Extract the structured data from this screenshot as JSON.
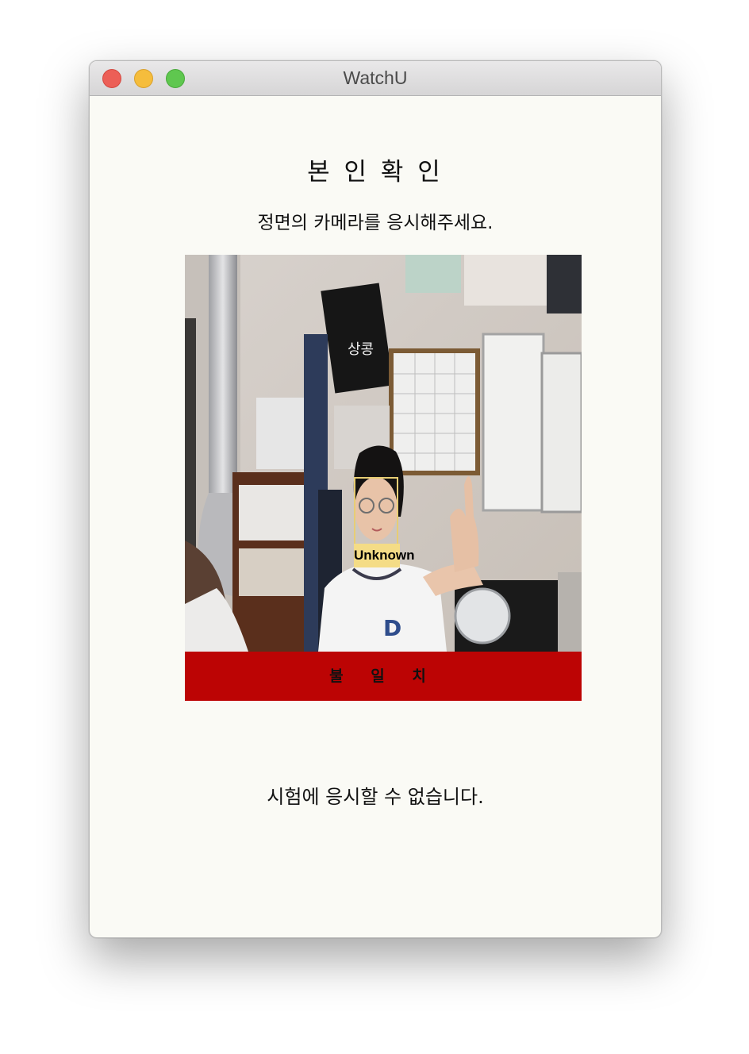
{
  "window": {
    "title": "WatchU"
  },
  "titlebar": {
    "buttons": [
      {
        "name": "close",
        "color": "#ec5f57"
      },
      {
        "name": "minimize",
        "color": "#f5bd3c"
      },
      {
        "name": "zoom",
        "color": "#5fc74f"
      }
    ]
  },
  "content": {
    "heading": "본 인 확 인",
    "instruction": "정면의 카메라를 응시해주세요.",
    "camera": {
      "face_label": "Unknown"
    },
    "result_banner": "불 일 치",
    "result_color": "#bc0404",
    "message": "시험에 응시할 수 없습니다."
  }
}
